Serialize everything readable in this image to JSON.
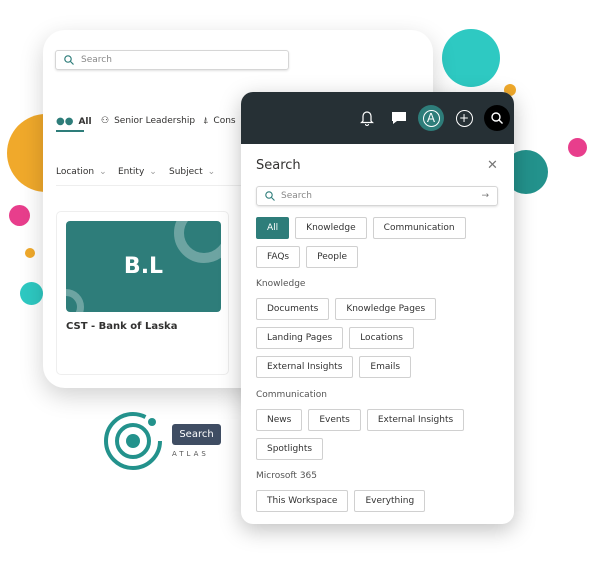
{
  "colors": {
    "accent": "#2e7d7a",
    "header": "#263035",
    "teal": "#2ec9c2",
    "pink": "#e83e8c",
    "orange": "#f0a92b"
  },
  "back_window": {
    "search_placeholder": "Search",
    "tabs": [
      {
        "label": "All",
        "icon": "people-icon",
        "active": true
      },
      {
        "label": "Senior Leadership",
        "icon": "person-lock-icon"
      },
      {
        "label": "Cons",
        "icon": "cone-icon"
      }
    ],
    "filters": [
      "Location",
      "Entity",
      "Subject"
    ],
    "card": {
      "logo": "B.L",
      "title": "CST - Bank of Laska"
    }
  },
  "brand": {
    "badge": "Search",
    "name": "ATLAS"
  },
  "panel": {
    "header_icons": [
      "bell-icon",
      "chat-icon",
      "atlas-icon",
      "add-icon",
      "search-icon"
    ],
    "title": "Search",
    "search_placeholder": "Search",
    "scopes": [
      "All",
      "Knowledge",
      "Communication",
      "FAQs",
      "People"
    ],
    "sections": [
      {
        "label": "Knowledge",
        "items": [
          "Documents",
          "Knowledge Pages",
          "Landing Pages",
          "Locations",
          "External Insights",
          "Emails"
        ]
      },
      {
        "label": "Communication",
        "items": [
          "News",
          "Events",
          "External Insights",
          "Spotlights"
        ]
      },
      {
        "label": "Microsoft 365",
        "items": [
          "This Workspace",
          "Everything"
        ]
      }
    ]
  }
}
